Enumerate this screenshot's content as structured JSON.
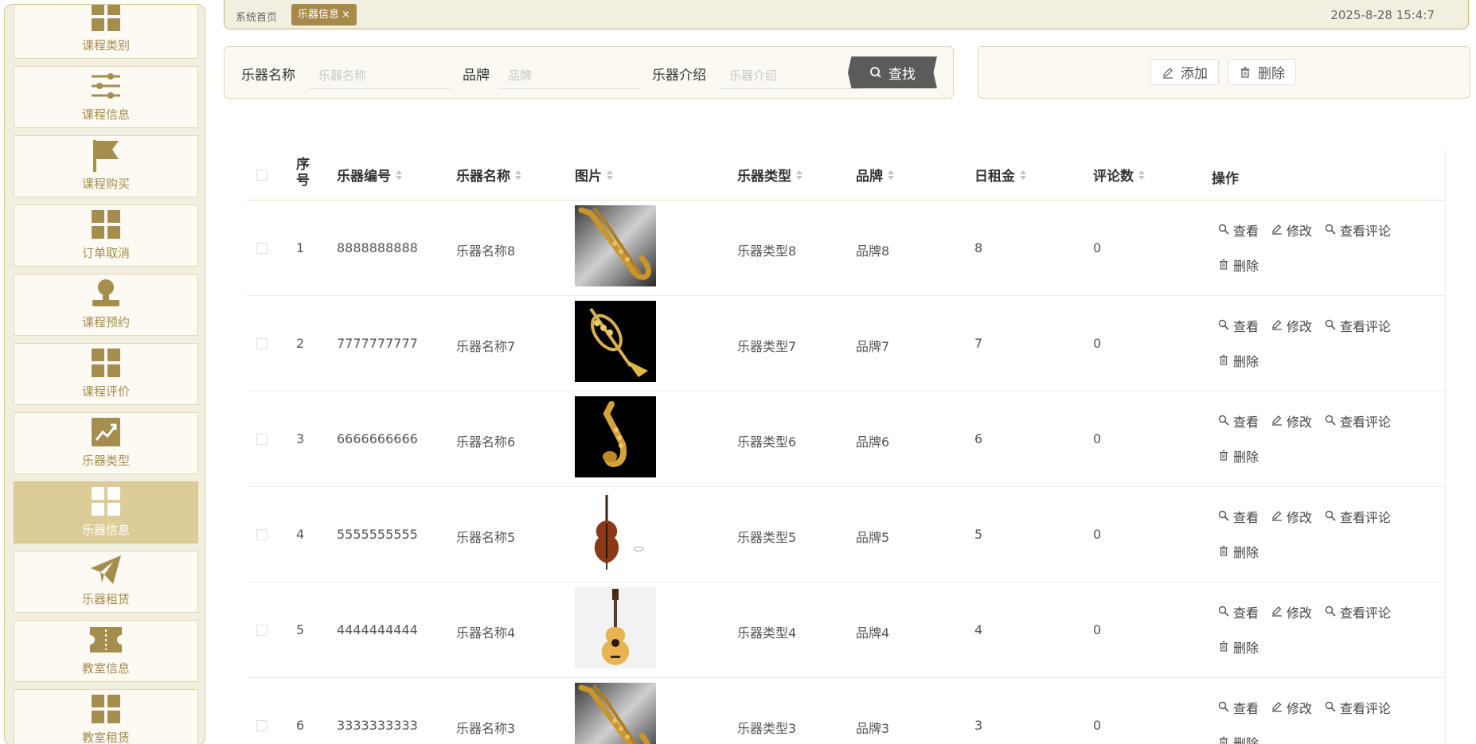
{
  "sidebar": {
    "items": [
      {
        "label": "课程类别",
        "icon": "grid-icon",
        "active": false
      },
      {
        "label": "课程信息",
        "icon": "sliders-icon",
        "active": false
      },
      {
        "label": "课程购买",
        "icon": "flag-icon",
        "active": false
      },
      {
        "label": "订单取消",
        "icon": "grid-icon",
        "active": false
      },
      {
        "label": "课程预约",
        "icon": "user-icon",
        "active": false
      },
      {
        "label": "课程评价",
        "icon": "grid-icon",
        "active": false
      },
      {
        "label": "乐器类型",
        "icon": "chart-icon",
        "active": false
      },
      {
        "label": "乐器信息",
        "icon": "grid-icon",
        "active": true
      },
      {
        "label": "乐器租赁",
        "icon": "paper-plane-icon",
        "active": false
      },
      {
        "label": "教室信息",
        "icon": "ticket-icon",
        "active": false
      },
      {
        "label": "教室租赁",
        "icon": "grid-icon",
        "active": false
      }
    ]
  },
  "topbar": {
    "home": "系统首页",
    "active_tab": "乐器信息",
    "close_glyph": "×",
    "datetime": "2025-8-28 15:4:7"
  },
  "search": {
    "name_label": "乐器名称",
    "name_placeholder": "乐器名称",
    "brand_label": "品牌",
    "brand_placeholder": "品牌",
    "intro_label": "乐器介绍",
    "intro_placeholder": "乐器介绍",
    "button": "查找"
  },
  "actions": {
    "add": "添加",
    "delete": "删除"
  },
  "table": {
    "headers": {
      "index_1": "序",
      "index_2": "号",
      "code": "乐器编号",
      "name": "乐器名称",
      "image": "图片",
      "type": "乐器类型",
      "brand": "品牌",
      "rent": "日租金",
      "comments": "评论数",
      "ops": "操作"
    },
    "op_labels": {
      "view": "查看",
      "edit": "修改",
      "view_comments": "查看评论",
      "delete": "删除"
    },
    "rows": [
      {
        "index": "1",
        "code": "8888888888",
        "name": "乐器名称8",
        "image": "saxophone-image",
        "type": "乐器类型8",
        "brand": "品牌8",
        "rent": "8",
        "comments": "0"
      },
      {
        "index": "2",
        "code": "7777777777",
        "name": "乐器名称7",
        "image": "trumpet-image",
        "type": "乐器类型7",
        "brand": "品牌7",
        "rent": "7",
        "comments": "0"
      },
      {
        "index": "3",
        "code": "6666666666",
        "name": "乐器名称6",
        "image": "alto-sax-image",
        "type": "乐器类型6",
        "brand": "品牌6",
        "rent": "6",
        "comments": "0"
      },
      {
        "index": "4",
        "code": "5555555555",
        "name": "乐器名称5",
        "image": "cello-image",
        "type": "乐器类型5",
        "brand": "品牌5",
        "rent": "5",
        "comments": "0"
      },
      {
        "index": "5",
        "code": "4444444444",
        "name": "乐器名称4",
        "image": "guitar-image",
        "type": "乐器类型4",
        "brand": "品牌4",
        "rent": "4",
        "comments": "0"
      },
      {
        "index": "6",
        "code": "3333333333",
        "name": "乐器名称3",
        "image": "saxophone-image",
        "type": "乐器类型3",
        "brand": "品牌3",
        "rent": "3",
        "comments": "0"
      }
    ]
  },
  "colors": {
    "accent": "#a7894a",
    "sidebar_active": "#dccc97",
    "sidebar_icon": "#a58d4e",
    "panel_bg": "#fbf9f2"
  }
}
